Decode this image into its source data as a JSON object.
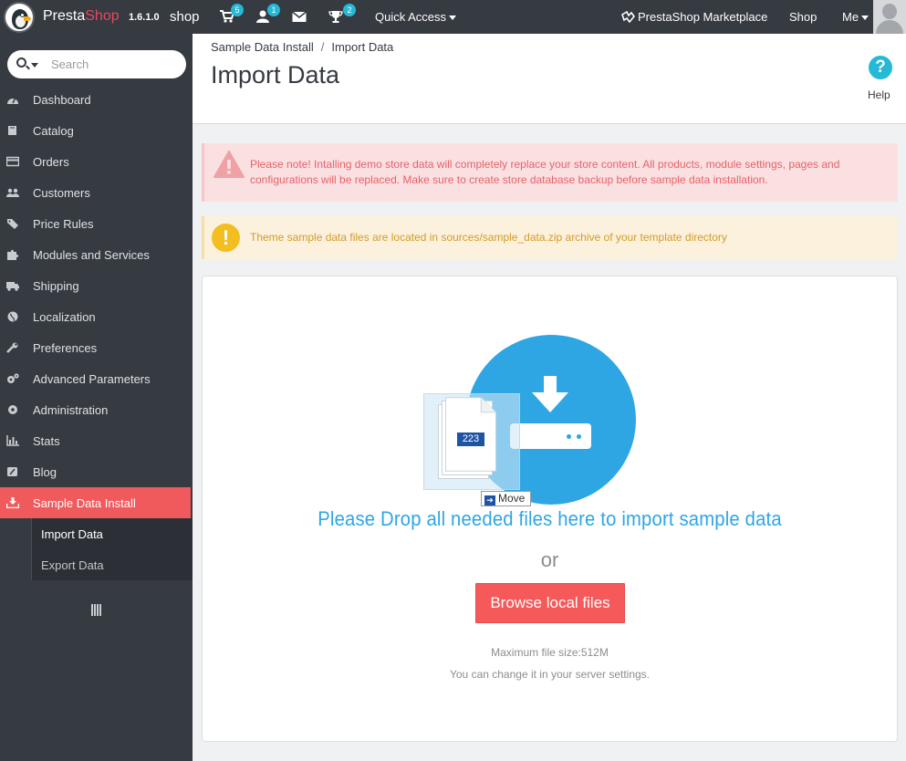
{
  "topbar": {
    "brand_presta": "Presta",
    "brand_shop": "Shop",
    "version": "1.6.1.0",
    "shop_name": "shop",
    "badges": {
      "orders": "5",
      "customers": "1",
      "messages": "",
      "trophy": "2"
    },
    "quick_access": "Quick Access",
    "marketplace": "PrestaShop Marketplace",
    "shop_link": "Shop",
    "me": "Me"
  },
  "sidebar": {
    "search_placeholder": "Search",
    "items": [
      {
        "label": "Dashboard",
        "icon": "dashboard-icon"
      },
      {
        "label": "Catalog",
        "icon": "book-icon"
      },
      {
        "label": "Orders",
        "icon": "credit-card-icon"
      },
      {
        "label": "Customers",
        "icon": "users-icon"
      },
      {
        "label": "Price Rules",
        "icon": "tags-icon"
      },
      {
        "label": "Modules and Services",
        "icon": "puzzle-icon"
      },
      {
        "label": "Shipping",
        "icon": "truck-icon"
      },
      {
        "label": "Localization",
        "icon": "globe-icon"
      },
      {
        "label": "Preferences",
        "icon": "wrench-icon"
      },
      {
        "label": "Advanced Parameters",
        "icon": "cogs-icon"
      },
      {
        "label": "Administration",
        "icon": "cog-icon"
      },
      {
        "label": "Stats",
        "icon": "bar-chart-icon"
      },
      {
        "label": "Blog",
        "icon": "edit-icon"
      },
      {
        "label": "Sample Data Install",
        "icon": "download-icon"
      }
    ],
    "subitems": [
      {
        "label": "Import Data"
      },
      {
        "label": "Export Data"
      }
    ]
  },
  "header": {
    "breadcrumb_parent": "Sample Data Install",
    "breadcrumb_sep": "/",
    "breadcrumb_current": "Import Data",
    "title": "Import Data",
    "help_label": "Help"
  },
  "alerts": {
    "danger": "Please note! Intalling demo store data will completely replace your store content. All products, module settings, pages and configurations will be replaced. Make sure to create store database backup before sample data installation.",
    "warning": "Theme sample data files are located in sources/sample_data.zip archive of your template directory"
  },
  "upload": {
    "file_count": "223",
    "move_tooltip": "Move",
    "drop_text": "Please Drop all needed files here to import sample data",
    "or": "or",
    "browse_button": "Browse local files",
    "max_size": "Maximum file size:512M",
    "change_note": "You can change it in your server settings."
  },
  "colors": {
    "topbar": "#363a41",
    "active_menu": "#f15a5d",
    "accent_blue": "#2ea6e3",
    "button_red": "#f55959",
    "danger_bg": "#fbe0e1",
    "warning_bg": "#fcf1dd"
  }
}
